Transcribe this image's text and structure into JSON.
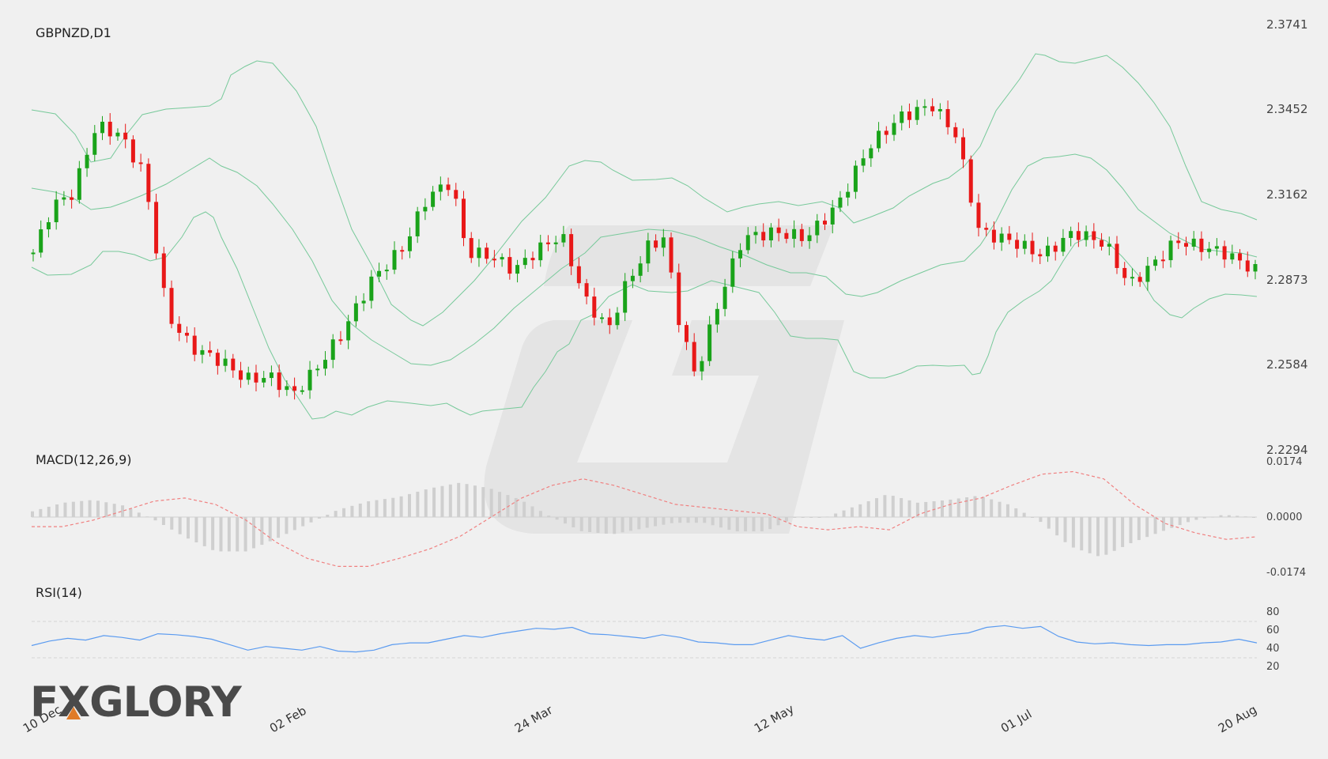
{
  "chart_data": {
    "type": "candlestick",
    "symbol_label": "GBPNZD,D1",
    "price_axis_ticks": [
      "2.3741",
      "2.3452",
      "2.3162",
      "2.2873",
      "2.2584",
      "2.2294"
    ],
    "price_range": [
      2.2294,
      2.3741
    ],
    "date_ticks": [
      "10 Dec",
      "02 Feb",
      "24 Mar",
      "12 May",
      "01 Jul",
      "20 Aug"
    ],
    "bollinger_mid_start_end": [
      2.3137,
      2.296
    ],
    "macd": {
      "label": "MACD(12,26,9)",
      "axis_ticks": [
        "0.0174",
        "0.0000",
        "-0.0174"
      ],
      "range": [
        -0.0174,
        0.0174
      ],
      "signal_line": [
        -0.003,
        -0.003,
        -0.001,
        0.002,
        0.005,
        0.006,
        0.004,
        -0.001,
        -0.008,
        -0.013,
        -0.0155,
        -0.0155,
        -0.013,
        -0.01,
        -0.006,
        0.0,
        0.006,
        0.01,
        0.012,
        0.01,
        0.007,
        0.004,
        0.003,
        0.002,
        0.001,
        -0.003,
        -0.004,
        -0.003,
        -0.004,
        0.001,
        0.004,
        0.006,
        0.01,
        0.0135,
        0.0143,
        0.012,
        0.004,
        -0.002,
        -0.005,
        -0.007,
        -0.0062
      ]
    },
    "rsi": {
      "label": "RSI(14)",
      "axis_ticks": [
        "80",
        "60",
        "40",
        "20"
      ],
      "levels": [
        70,
        30
      ],
      "values": [
        43,
        48,
        51,
        49,
        54,
        52,
        49,
        56,
        55,
        53,
        50,
        44,
        38,
        42,
        40,
        38,
        42,
        37,
        36,
        38,
        44,
        46,
        46,
        50,
        54,
        52,
        56,
        59,
        62,
        61,
        63,
        56,
        55,
        53,
        51,
        55,
        52,
        47,
        46,
        44,
        44,
        49,
        54,
        51,
        49,
        54,
        40,
        46,
        51,
        54,
        52,
        55,
        57,
        63,
        65,
        62,
        64,
        53,
        47,
        45,
        46,
        44,
        43,
        44,
        44,
        46,
        47,
        50,
        46
      ]
    }
  },
  "brand": {
    "logo_text": "FXGLORY",
    "accent_color": "#e07b28",
    "bull_color": "#1aa31a",
    "bear_color": "#e81818",
    "band_color": "#77c99a",
    "macd_signal_color": "#f08080",
    "rsi_color": "#5b9bf0"
  }
}
